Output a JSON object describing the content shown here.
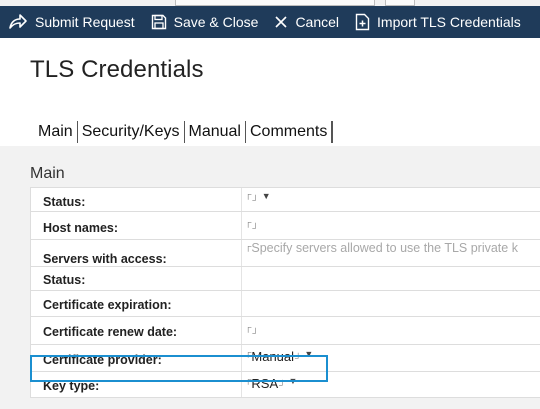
{
  "toolbar": {
    "submit_label": "Submit Request",
    "save_close_label": "Save & Close",
    "cancel_label": "Cancel",
    "import_label": "Import TLS Credentials",
    "background": "#1f3b5a"
  },
  "page": {
    "title": "TLS Credentials"
  },
  "tabs": [
    {
      "label": "Main"
    },
    {
      "label": "Security/Keys"
    },
    {
      "label": "Manual"
    },
    {
      "label": "Comments"
    }
  ],
  "section": {
    "title": "Main"
  },
  "fields": [
    {
      "label": "Status:",
      "value": "",
      "dropdown": true
    },
    {
      "label": "Host names:",
      "value": ""
    },
    {
      "label": "Servers with access:",
      "placeholder": "Specify servers allowed to use the TLS private k"
    },
    {
      "label": "Status:",
      "value": ""
    },
    {
      "label": "Certificate expiration:",
      "value": ""
    },
    {
      "label": "Certificate renew date:",
      "value": ""
    },
    {
      "label": "Certificate provider:",
      "value": "Manual",
      "dropdown": true,
      "highlighted": true
    },
    {
      "label": "Key type:",
      "value": "RSA",
      "dropdown": true
    }
  ],
  "highlight_color": "#1b8fd0"
}
